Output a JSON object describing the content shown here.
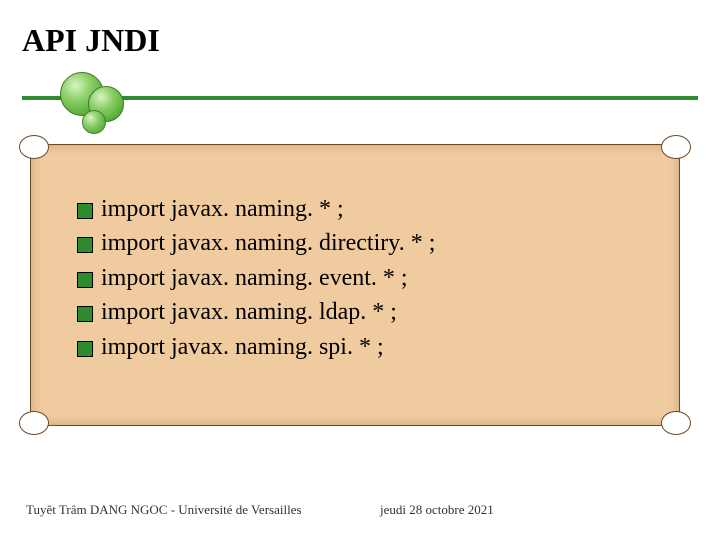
{
  "title": "API JNDI",
  "bullets": [
    "import javax. naming. * ;",
    "import javax. naming. directiry. * ;",
    "import javax. naming. event. * ;",
    "import javax. naming. ldap. * ;",
    "import javax. naming. spi. * ;"
  ],
  "footer": {
    "left": "Tuyêt Trâm DANG NGOC - Université de Versailles",
    "right": "jeudi 28 octobre 2021"
  },
  "colors": {
    "accent": "#2e8b2e",
    "parchment": "#f0cba0"
  }
}
